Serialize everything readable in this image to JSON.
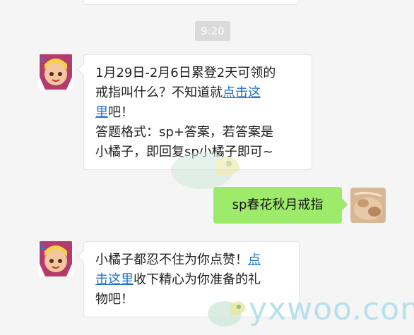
{
  "chat": {
    "timestamp": "9:20",
    "messages": [
      {
        "sender": "bot",
        "lines": [
          [
            "1月29日-2月6日累登2天可领的"
          ],
          [
            "戒指叫什么？不知道就",
            {
              "link": "点击这"
            }
          ],
          [
            {
              "link": "里"
            },
            "吧！"
          ],
          [
            "答题格式：sp+答案，若答案是"
          ],
          [
            "小橘子，即回复sp小橘子即可~"
          ]
        ]
      },
      {
        "sender": "me",
        "text": "sp春花秋月戒指"
      },
      {
        "sender": "bot",
        "lines": [
          [
            "小橘子都忍不住为你点赞！",
            {
              "link": "点"
            }
          ],
          [
            {
              "link": "击这里"
            },
            "收下精心为你准备的礼"
          ],
          [
            "物吧！"
          ]
        ]
      }
    ]
  },
  "watermark": {
    "text": "yxwoo.com"
  },
  "colors": {
    "background": "#f5f5f5",
    "my_bubble": "#9eea6a",
    "link": "#1e6fd0"
  }
}
